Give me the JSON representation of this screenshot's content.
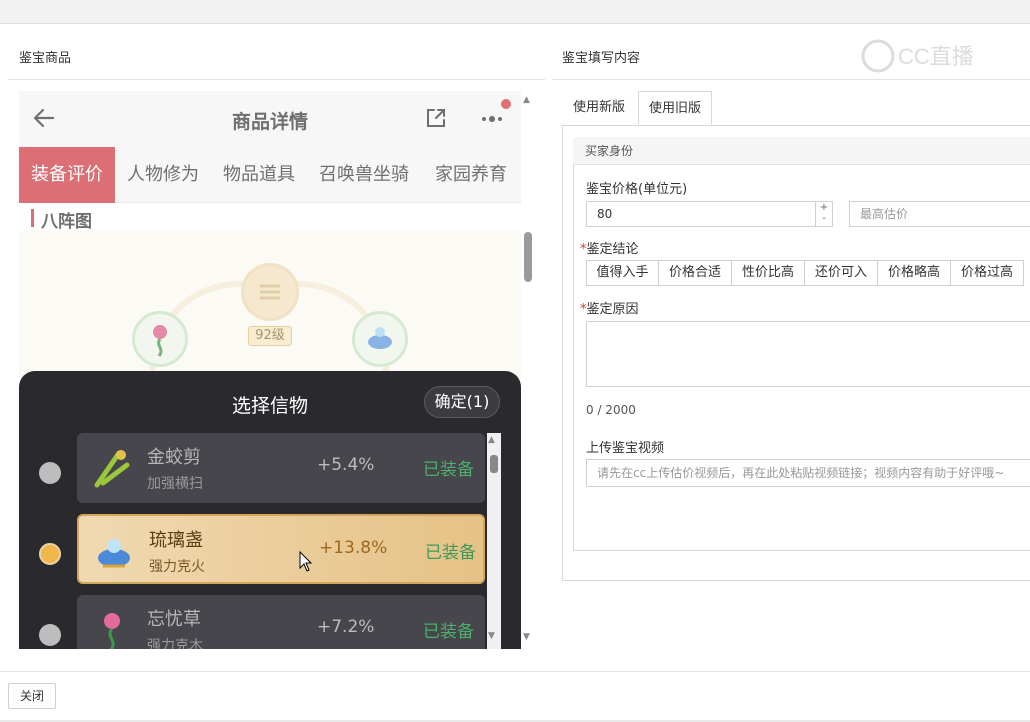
{
  "left_panel": {
    "title": "鉴宝商品"
  },
  "right_panel": {
    "title": "鉴宝填写内容"
  },
  "watermark": {
    "text": "CC直播"
  },
  "phone": {
    "header": {
      "title": "商品详情"
    },
    "tabs": [
      {
        "label": "装备评价",
        "active": true
      },
      {
        "label": "人物修为",
        "active": false
      },
      {
        "label": "物品道具",
        "active": false
      },
      {
        "label": "召唤兽坐骑",
        "active": false
      },
      {
        "label": "家园养育",
        "active": false
      }
    ],
    "section_title": "八阵图",
    "level_badge": "92级",
    "sheet": {
      "title": "选择信物",
      "confirm_label": "确定(1)",
      "items": [
        {
          "name": "金蛟剪",
          "sub": "加强横扫",
          "pct": "+5.4%",
          "status": "已装备",
          "selected": false
        },
        {
          "name": "琉璃盏",
          "sub": "强力克火",
          "pct": "+13.8%",
          "status": "已装备",
          "selected": true
        },
        {
          "name": "忘忧草",
          "sub": "强力克木",
          "pct": "+7.2%",
          "status": "已装备",
          "selected": false
        }
      ]
    }
  },
  "form": {
    "tabs": [
      {
        "label": "使用新版",
        "active": false
      },
      {
        "label": "使用旧版",
        "active": true
      }
    ],
    "section_head": "买家身份",
    "price_label": "鉴宝价格(单位元)",
    "price_value": "80",
    "max_estimate_placeholder": "最高估价",
    "conclusion_label": "鉴定结论",
    "conclusion_options": [
      "值得入手",
      "价格合适",
      "性价比高",
      "还价可入",
      "价格略高",
      "价格过高"
    ],
    "reason_label": "鉴定原因",
    "char_count": "0 / 2000",
    "video_label": "上传鉴宝视频",
    "video_placeholder": "请先在cc上传估价视频后，再在此处粘贴视频链接；视频内容有助于好评哦~"
  },
  "footer": {
    "close_label": "关闭"
  }
}
